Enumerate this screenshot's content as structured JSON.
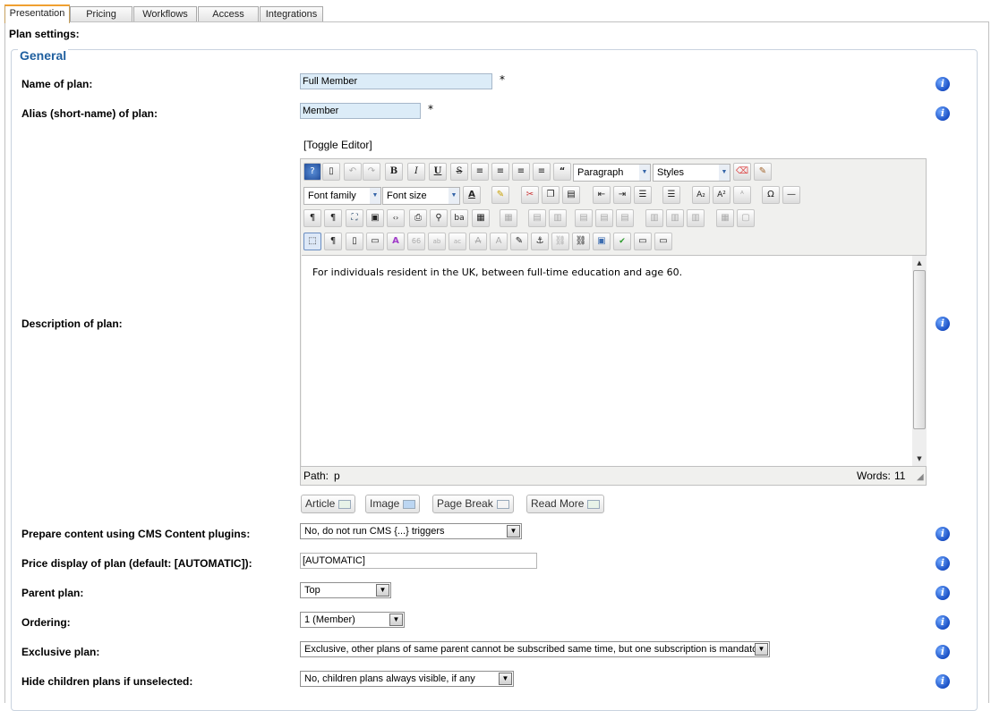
{
  "tabs": [
    {
      "label": "Presentation",
      "active": true
    },
    {
      "label": "Pricing"
    },
    {
      "label": "Workflows"
    },
    {
      "label": "Access"
    },
    {
      "label": "Integrations"
    }
  ],
  "section_title": "Plan settings:",
  "legend": "General",
  "required_mark": "*",
  "fields": {
    "name": {
      "label": "Name of plan:",
      "value": "Full Member"
    },
    "alias": {
      "label": "Alias (short-name) of plan:",
      "value": "Member"
    },
    "description": {
      "label": "Description of plan:"
    },
    "prepare": {
      "label": "Prepare content using CMS Content plugins:",
      "value": "No, do not run CMS {...} triggers"
    },
    "price": {
      "label": "Price display of plan (default: [AUTOMATIC]):",
      "value": "[AUTOMATIC]"
    },
    "parent": {
      "label": "Parent plan:",
      "value": "Top"
    },
    "ordering": {
      "label": "Ordering:",
      "value": "1 (Member)"
    },
    "exclusive": {
      "label": "Exclusive plan:",
      "value": "Exclusive, other plans of same parent cannot be subscribed same time, but one subscription is mandatory"
    },
    "hide_children": {
      "label": "Hide children plans if unselected:",
      "value": "No, children plans always visible, if any"
    }
  },
  "editor": {
    "toggle_label": "[Toggle Editor]",
    "format_select": "Paragraph",
    "styles_select": "Styles",
    "font_family_select": "Font family",
    "font_size_select": "Font size",
    "content": "For individuals resident in the UK, between full-time education and age 60.",
    "path_label": "Path:",
    "path_value": "p",
    "words_label": "Words:",
    "words_count": "11"
  },
  "extra_buttons": {
    "article": "Article",
    "image": "Image",
    "page_break": "Page Break",
    "read_more": "Read More"
  },
  "info_glyph": "i",
  "colors": {
    "accent": "#1f5f9f",
    "input_bg": "#dcecf8",
    "active_tab_border": "#f0a030"
  }
}
